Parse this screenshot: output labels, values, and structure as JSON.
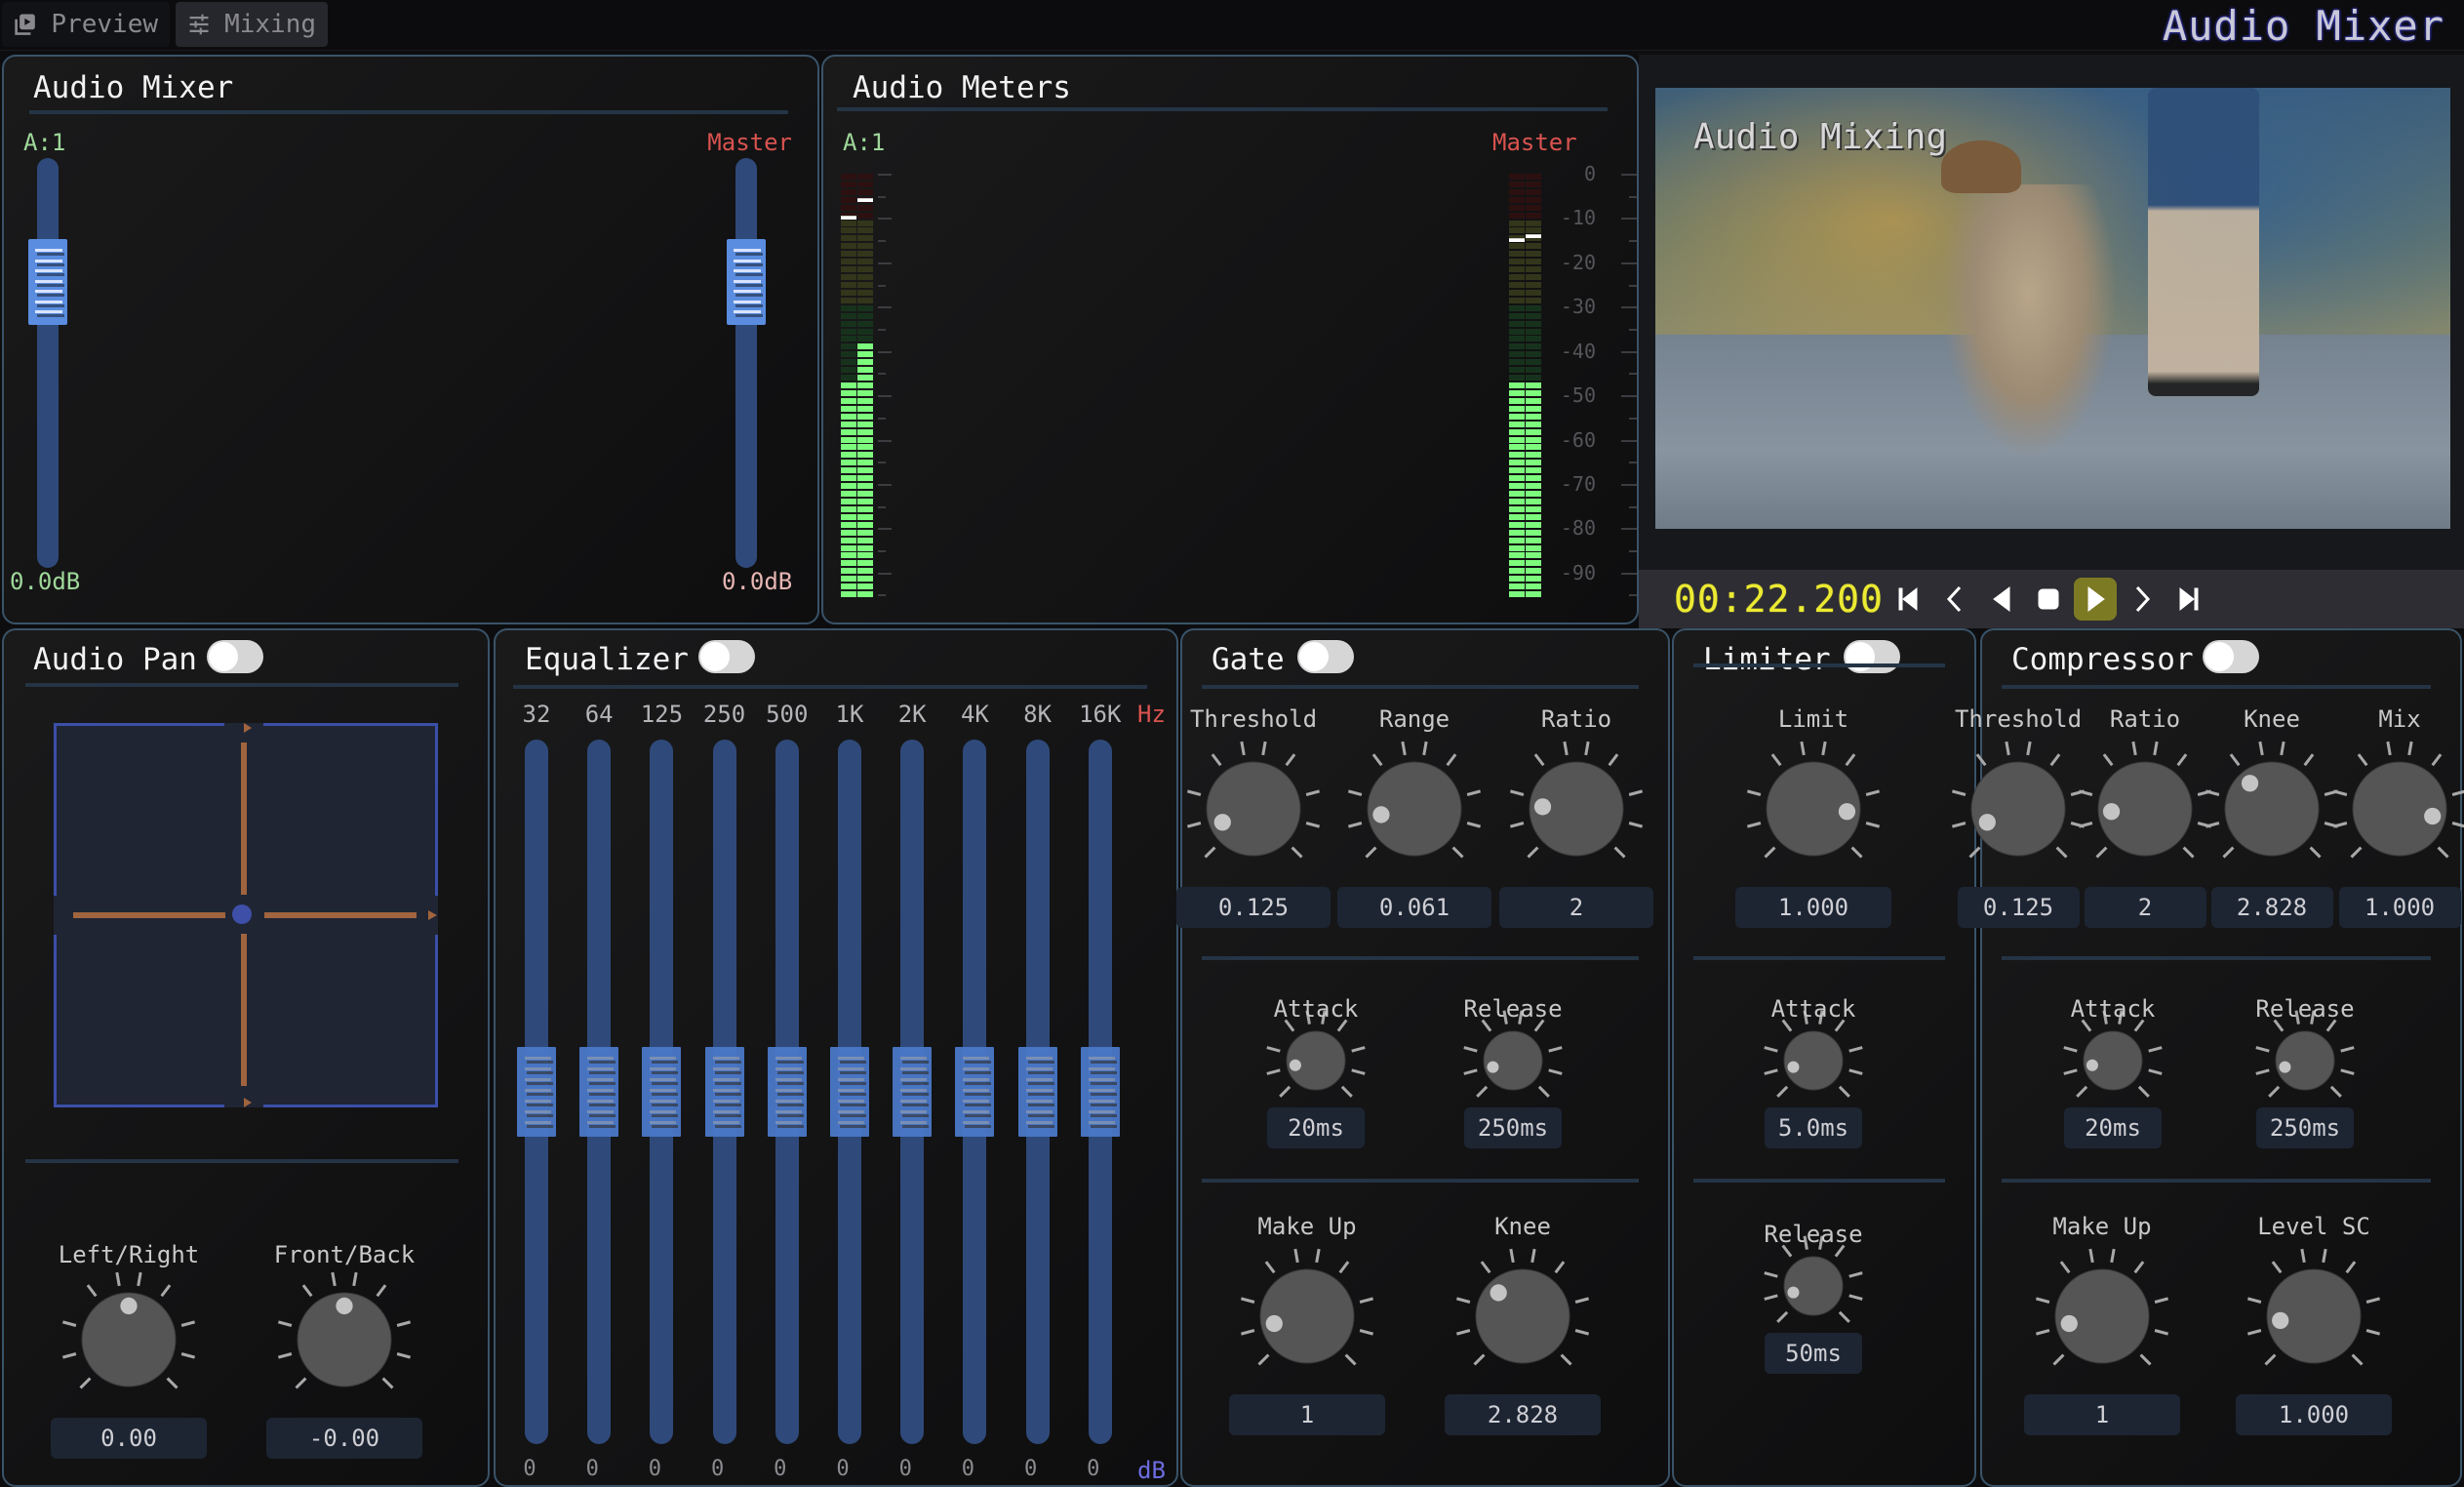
{
  "tabs": [
    {
      "label": "Preview",
      "icon": "play-square-icon",
      "active": false
    },
    {
      "label": "Mixing",
      "icon": "sliders-icon",
      "active": true
    }
  ],
  "app_title": "Audio Mixer",
  "mixer": {
    "title": "Audio Mixer",
    "channels": [
      {
        "label": "A:1",
        "gain_label": "0.0dB",
        "fader_position": 0.75,
        "color": "#9fd89a"
      },
      {
        "label": "Master",
        "gain_label": "0.0dB",
        "fader_position": 0.75,
        "color": "#d9534f"
      }
    ]
  },
  "meters": {
    "title": "Audio Meters",
    "range_db": [
      0,
      -96
    ],
    "scale_labels": [
      "0",
      "-10",
      "-20",
      "-30",
      "-40",
      "-50",
      "-60",
      "-70",
      "-80",
      "-90"
    ],
    "groups": [
      {
        "label": "A:1",
        "channels": [
          {
            "level_db": -47,
            "peak_db": -10
          },
          {
            "level_db": -38,
            "peak_db": -6
          }
        ]
      },
      {
        "label": "Master",
        "channels": [
          {
            "level_db": -47,
            "peak_db": -15
          },
          {
            "level_db": -47,
            "peak_db": -14
          }
        ]
      }
    ],
    "colors": {
      "lit_green": "#7dfb7d",
      "dim_green": "#17321c",
      "dim_yellow": "#33361a",
      "dim_red": "#2c1010"
    }
  },
  "video": {
    "overlay_text": "Audio Mixing",
    "timecode": "00:22.200",
    "transport": [
      {
        "name": "skip-to-start-icon"
      },
      {
        "name": "step-back-icon"
      },
      {
        "name": "play-reverse-icon"
      },
      {
        "name": "stop-icon"
      },
      {
        "name": "play-icon",
        "active": true
      },
      {
        "name": "step-forward-icon"
      },
      {
        "name": "skip-to-end-icon"
      }
    ]
  },
  "pan": {
    "title": "Audio Pan",
    "enabled": false,
    "knobs": [
      {
        "label": "Left/Right",
        "value": "0.00",
        "position": 0.5
      },
      {
        "label": "Front/Back",
        "value": "-0.00",
        "position": 0.5
      }
    ]
  },
  "equalizer": {
    "title": "Equalizer",
    "enabled": false,
    "freq_unit": "Hz",
    "gain_unit": "dB",
    "bands": [
      {
        "freq": "32",
        "gain": "0"
      },
      {
        "freq": "64",
        "gain": "0"
      },
      {
        "freq": "125",
        "gain": "0"
      },
      {
        "freq": "250",
        "gain": "0"
      },
      {
        "freq": "500",
        "gain": "0"
      },
      {
        "freq": "1K",
        "gain": "0"
      },
      {
        "freq": "2K",
        "gain": "0"
      },
      {
        "freq": "4K",
        "gain": "0"
      },
      {
        "freq": "8K",
        "gain": "0"
      },
      {
        "freq": "16K",
        "gain": "0"
      }
    ]
  },
  "gate": {
    "title": "Gate",
    "enabled": false,
    "knobs": [
      {
        "label": "Threshold",
        "value": "0.125",
        "position": 0.08
      },
      {
        "label": "Range",
        "value": "0.061",
        "position": 0.13
      },
      {
        "label": "Ratio",
        "value": "2",
        "position": 0.18
      },
      {
        "label": "Attack",
        "value": "20ms",
        "position": 0.12
      },
      {
        "label": "Release",
        "value": "250ms",
        "position": 0.1
      },
      {
        "label": "Make Up",
        "value": "1",
        "position": 0.12
      },
      {
        "label": "Knee",
        "value": "2.828",
        "position": 0.33
      }
    ]
  },
  "limiter": {
    "title": "Limiter",
    "enabled": false,
    "knobs": [
      {
        "label": "Limit",
        "value": "1.000",
        "position": 0.85
      },
      {
        "label": "Attack",
        "value": "5.0ms",
        "position": 0.1
      },
      {
        "label": "Release",
        "value": "50ms",
        "position": 0.1
      }
    ]
  },
  "compressor": {
    "title": "Compressor",
    "enabled": false,
    "knobs": [
      {
        "label": "Threshold",
        "value": "0.125",
        "position": 0.08
      },
      {
        "label": "Ratio",
        "value": "2",
        "position": 0.15
      },
      {
        "label": "Knee",
        "value": "2.828",
        "position": 0.35
      },
      {
        "label": "Mix",
        "value": "1.000",
        "position": 0.88
      },
      {
        "label": "Attack",
        "value": "20ms",
        "position": 0.12
      },
      {
        "label": "Release",
        "value": "250ms",
        "position": 0.1
      },
      {
        "label": "Make Up",
        "value": "1",
        "position": 0.12
      },
      {
        "label": "Level SC",
        "value": "1.000",
        "position": 0.14
      }
    ]
  }
}
